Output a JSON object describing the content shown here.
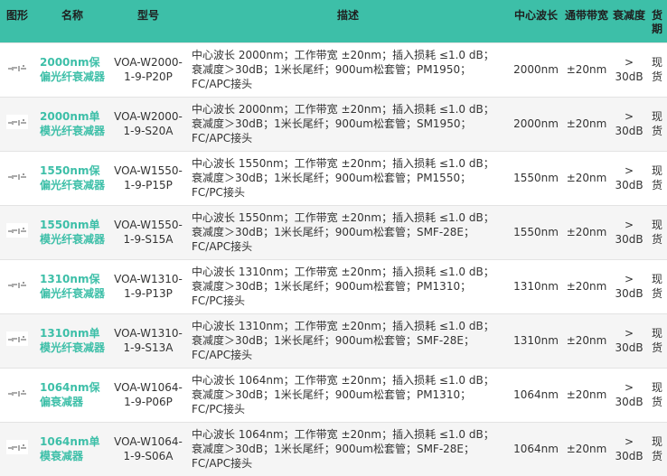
{
  "header": {
    "image": "图形",
    "name": "名称",
    "model": "型号",
    "desc": "描述",
    "wavelength": "中心波长",
    "bandwidth": "通带带宽",
    "attenuation": "衰减度",
    "stock": "货期"
  },
  "rows": [
    {
      "name": "2000nm保偏光纤衰减器",
      "model": "VOA-W2000-1-9-P20P",
      "desc": "中心波长 2000nm；工作带宽 ±20nm；插入损耗 ≤1.0 dB；衰减度＞30dB；1米长尾纤；900um松套管；PM1950；FC/APC接头",
      "wavelength": "2000nm",
      "bandwidth": "±20nm",
      "attenuation": "> 30dB",
      "stock": "现货"
    },
    {
      "name": "2000nm单模光纤衰减器",
      "model": "VOA-W2000-1-9-S20A",
      "desc": "中心波长 2000nm；工作带宽 ±20nm；插入损耗 ≤1.0 dB；衰减度＞30dB；1米长尾纤；900um松套管；SM1950；FC/APC接头",
      "wavelength": "2000nm",
      "bandwidth": "±20nm",
      "attenuation": "> 30dB",
      "stock": "现货"
    },
    {
      "name": "1550nm保偏光纤衰减器",
      "model": "VOA-W1550-1-9-P15P",
      "desc": "中心波长 1550nm；工作带宽 ±20nm；插入损耗 ≤1.0 dB；衰减度＞30dB；1米长尾纤；900um松套管；PM1550；FC/PC接头",
      "wavelength": "1550nm",
      "bandwidth": "±20nm",
      "attenuation": "> 30dB",
      "stock": "现货"
    },
    {
      "name": "1550nm单模光纤衰减器",
      "model": "VOA-W1550-1-9-S15A",
      "desc": "中心波长 1550nm；工作带宽 ±20nm；插入损耗 ≤1.0 dB；衰减度＞30dB；1米长尾纤；900um松套管；SMF-28E；FC/APC接头",
      "wavelength": "1550nm",
      "bandwidth": "±20nm",
      "attenuation": "> 30dB",
      "stock": "现货"
    },
    {
      "name": "1310nm保偏光纤衰减器",
      "model": "VOA-W1310-1-9-P13P",
      "desc": "中心波长 1310nm；工作带宽 ±20nm；插入损耗 ≤1.0 dB；衰减度＞30dB；1米长尾纤；900um松套管；PM1310；FC/PC接头",
      "wavelength": "1310nm",
      "bandwidth": "±20nm",
      "attenuation": "> 30dB",
      "stock": "现货"
    },
    {
      "name": "1310nm单模光纤衰减器",
      "model": "VOA-W1310-1-9-S13A",
      "desc": "中心波长 1310nm；工作带宽 ±20nm；插入损耗 ≤1.0 dB；衰减度＞30dB；1米长尾纤；900um松套管；SMF-28E；FC/APC接头",
      "wavelength": "1310nm",
      "bandwidth": "±20nm",
      "attenuation": "> 30dB",
      "stock": "现货"
    },
    {
      "name": "1064nm保偏衰减器",
      "model": "VOA-W1064-1-9-P06P",
      "desc": "中心波长 1064nm；工作带宽 ±20nm；插入损耗 ≤1.0 dB；衰减度＞30dB；1米长尾纤；900um松套管；PM1310；FC/PC接头",
      "wavelength": "1064nm",
      "bandwidth": "±20nm",
      "attenuation": "> 30dB",
      "stock": "现货"
    },
    {
      "name": "1064nm单模衰减器",
      "model": "VOA-W1064-1-9-S06A",
      "desc": "中心波长 1064nm；工作带宽 ±20nm；插入损耗 ≤1.0 dB；衰减度＞30dB；1米长尾纤；900um松套管；SMF-28E；FC/APC接头",
      "wavelength": "1064nm",
      "bandwidth": "±20nm",
      "attenuation": "> 30dB",
      "stock": "现货"
    }
  ],
  "colors": {
    "header_bg": "#3dbfa8",
    "name_text": "#3dbfa8",
    "alt_row_bg": "#f5f5f5"
  },
  "icons": {
    "thumbnail": "product-thumbnail-icon"
  }
}
